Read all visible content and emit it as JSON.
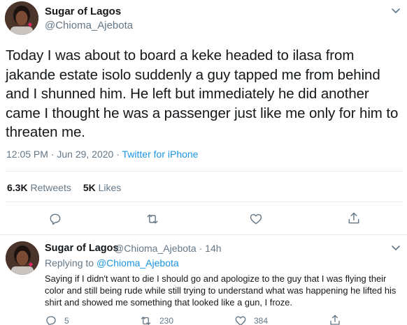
{
  "main_tweet": {
    "author_name": "Sugar of Lagos",
    "author_handle": "@Chioma_Ajebota",
    "text": "Today I was about to board a keke headed to ilasa from jakande estate isolo suddenly a guy tapped me from behind and I shunned him. He left but immediately he did another came I thought he was a passenger just like me only for him to threaten me.",
    "timestamp": "12:05 PM · Jun 29, 2020",
    "separator": " · ",
    "source": "Twitter for iPhone",
    "retweets_count": "6.3K",
    "retweets_label": "Retweets",
    "likes_count": "5K",
    "likes_label": "Likes"
  },
  "reply_tweet": {
    "author_name": "Sugar of Lagos",
    "author_handle_time": "@Chioma_Ajebota · 14h",
    "replying_prefix": "Replying to",
    "replying_to": "@Chioma_Ajebota",
    "text": "Saying if I didn't want to die I should go and apologize to the guy that I was flying their color and still being rude while still trying to understand what was happening he lifted his shirt and showed me something that looked like a gun, I froze.",
    "reply_count": "5",
    "retweet_count": "230",
    "like_count": "384"
  },
  "colors": {
    "text": "#14171a",
    "secondary": "#657786",
    "link": "#1b95e0",
    "divider": "#e6ecf0"
  },
  "icons": [
    "chevron-down-icon",
    "reply-icon",
    "retweet-icon",
    "like-icon",
    "share-icon"
  ]
}
